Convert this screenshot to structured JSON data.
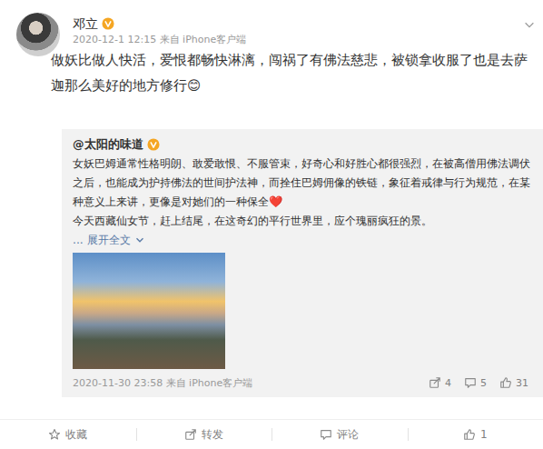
{
  "post": {
    "author": "邓立",
    "verified": true,
    "time": "2020-12-1 12:15 来自 iPhone客户端",
    "text": "做妖比做人快活，爱恨都畅快淋漓，闯祸了有佛法慈悲，被锁拿收服了也是去萨迦那么美好的地方修行😊"
  },
  "repost": {
    "author": "@太阳的味道",
    "verified": true,
    "paragraphs": [
      "女妖巴姆通常性格明朗、敢爱敢恨、不服管束，好奇心和好胜心都很强烈，在被高僧用佛法调伏之后，也能成为护持佛法的世间护法神，而拴住巴姆佣像的铁链，象征着戒律与行为规范，在某种意义上来讲，更像是对她们的一种保全❤️",
      "今天西藏仙女节，赶上结尾，在这奇幻的平行世界里，应个瑰丽疯狂的景。"
    ],
    "expand": "... 展开全文",
    "time": "2020-11-30 23:58 来自 iPhone客户端",
    "stats": [
      {
        "kind": "share",
        "count": "4"
      },
      {
        "kind": "comment",
        "count": "5"
      },
      {
        "kind": "like",
        "count": "31"
      }
    ]
  },
  "actions": [
    {
      "kind": "favorite",
      "label": "收藏"
    },
    {
      "kind": "share",
      "label": "转发"
    },
    {
      "kind": "comment",
      "label": "评论"
    },
    {
      "kind": "like",
      "label": "1"
    }
  ]
}
